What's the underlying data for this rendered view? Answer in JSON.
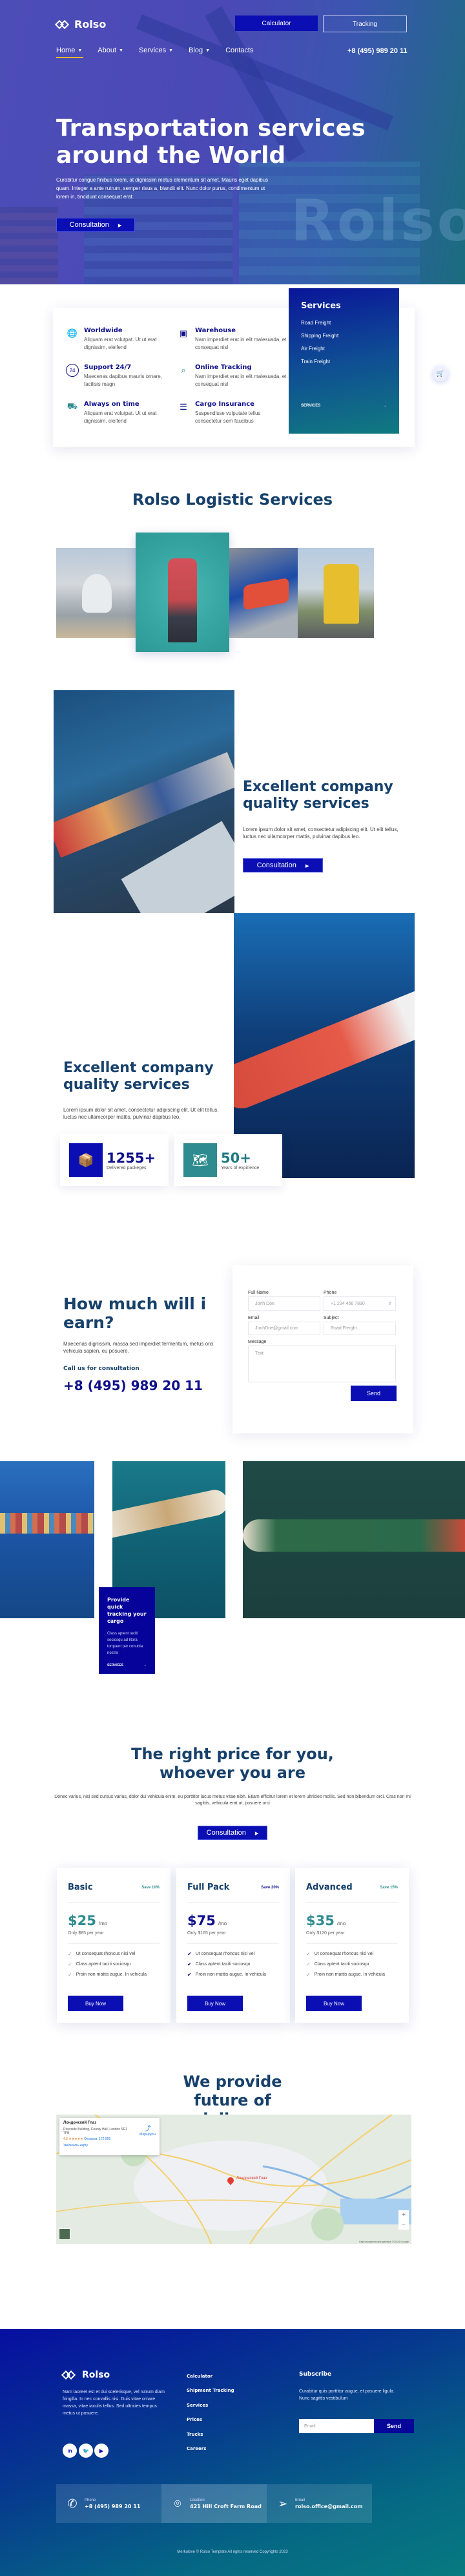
{
  "header": {
    "brand": "Rolso",
    "calculator_label": "Calculator",
    "tracking_label": "Tracking",
    "nav": [
      {
        "label": "Home",
        "dropdown": true,
        "active": true
      },
      {
        "label": "About",
        "dropdown": true
      },
      {
        "label": "Services",
        "dropdown": true
      },
      {
        "label": "Blog",
        "dropdown": true
      },
      {
        "label": "Contacts",
        "dropdown": false
      }
    ],
    "phone": "+8 (495) 989 20 11"
  },
  "hero": {
    "title": "Transportation services around the World",
    "text": "Curabitur congue finibus lorem, at dignissim metus elementum sit amet. Mauris eget dapibus quam. Integer a ante rutrum, semper risus a, blandit elit. Nunc dolor purus, condimentum ut lorem in, tincidunt consequat erat.",
    "button_label": "Consultation",
    "watermark": "Rolso"
  },
  "features": [
    {
      "icon": "globe-icon",
      "title": "Worldwide",
      "desc": "Aliquam erat volutpat. Ut ut erat dignissim, eleifend"
    },
    {
      "icon": "warehouse-box-icon",
      "title": "Warehouse",
      "desc": "Nam imperdiet erat in elit malesuada, et consequat nisl"
    },
    {
      "icon": "support-24-icon",
      "title": "Support 24/7",
      "desc": "Maecenas dapibus mauris ornare, facilisis magn"
    },
    {
      "icon": "tracking-search-icon",
      "title": "Online Tracking",
      "desc": "Nam imperdiet erat in elit malesuada, et consequat nisl"
    },
    {
      "icon": "truck-clock-icon",
      "title": "Always on time",
      "desc": "Aliquam erat volutpat. Ut ut erat dignissim, eleifend"
    },
    {
      "icon": "clipboard-icon",
      "title": "Cargo Insurance",
      "desc": "Suspendisse vulputate tellus consectetur sem faucibus"
    }
  ],
  "services_panel": {
    "title": "Services",
    "links": [
      "Road Freight",
      "Shipping Freight",
      "Air Freight",
      "Train Freight"
    ],
    "more_label": "SERVICES"
  },
  "logistic": {
    "title": "Rolso Logistic Services",
    "images": [
      "airplane-photo",
      "container-ship-photo",
      "train-photo",
      "truck-photo"
    ]
  },
  "excellent_1": {
    "title": "Excellent company quality services",
    "text": "Lorem ipsum dolor sit amet, consectetur adipiscing elit. Ut elit tellus, luctus nec ullamcorper mattis, pulvinar dapibus leo.",
    "button_label": "Consultation"
  },
  "excellent_2": {
    "title": "Excellent company quality services",
    "text": "Lorem ipsum dolor sit amet, consectetur adipiscing elit. Ut elit tellus, luctus nec ullamcorper mattis, pulvinar dapibus leo.",
    "stats": [
      {
        "value": "1255+",
        "label": "Delivered packeges",
        "color": "#0b0fb3"
      },
      {
        "value": "50+",
        "label": "Years of expirience",
        "color": "#2e8b8f"
      }
    ]
  },
  "earn": {
    "title": "How much will i earn?",
    "text": "Maecenas dignissim, massa sed imperdiet fermentum, metus orci vehicula sapien, eu posuere.",
    "call_label": "Call us for consultation",
    "phone": "+8 (495) 989 20 11"
  },
  "form": {
    "full_name_label": "Full Name",
    "full_name_placeholder": "Jonh Doe",
    "phone_label": "Phone",
    "phone_placeholder": "+1 234 456 7890",
    "email_label": "Email",
    "email_placeholder": "JonhDoe@gmail.com",
    "subject_label": "Subject",
    "subject_value": "Road Freight",
    "message_label": "Message",
    "message_placeholder": "Text",
    "send_label": "Send"
  },
  "tracking_card": {
    "title": "Provide quick tracking your cargo",
    "text": "Class aptent taciti sociosqu ad litora torquent per conubia nostra",
    "more_label": "SERVICES"
  },
  "pricing": {
    "title": "The right price for you, whoever you are",
    "text": "Donec varius, nisi sed cursus varius, dolor dui vehicula enim, eu porttitor lacus metus vitae nibh. Etiam efficitur lorem et lorem ultricies mollis. Sed non bibendum orci. Cras non mi sagittis, vehicula erat ut, posuere orci",
    "button_label": "Consultation",
    "plans": [
      {
        "name": "Basic",
        "save": "Save 10%",
        "price": "$25",
        "per": "/mo",
        "year": "Only $85 per year",
        "accent": "#2e8b8f",
        "features": [
          "Ut consequat rhoncus nisi vel",
          "Class aptent taciti sociosqu",
          "Proin non mattis augue. In vehicula"
        ],
        "buy_label": "Buy Now"
      },
      {
        "name": "Full Pack",
        "save": "Save 20%",
        "price": "$75",
        "per": "/mo",
        "year": "Only $165 per year",
        "accent": "#0e0f8a",
        "features": [
          "Ut consequat rhoncus nisi vel",
          "Class aptent taciti sociosqu",
          "Proin non mattis augue. In vehicula"
        ],
        "buy_label": "Buy Now"
      },
      {
        "name": "Advanced",
        "save": "Save 15%",
        "price": "$35",
        "per": "/mo",
        "year": "Only $120 per year",
        "accent": "#2e8b8f",
        "features": [
          "Ut consequat rhoncus nisi vel",
          "Class aptent taciti sociosqu",
          "Proin non mattis augue. In vehicula"
        ],
        "buy_label": "Buy Now"
      }
    ]
  },
  "map": {
    "title": "We provide future of delivery",
    "place_name": "Лондонский Глаз",
    "address": "Riverside Building, County Hall, London SE1 7PB",
    "rating": "4,5 ★★★★★",
    "reviews": "Отзывов: 172 066",
    "enlarge": "Увеличить карту",
    "routes": "Маршруты",
    "marker_label": "Лондонский Глаз",
    "zoom_in": "+",
    "zoom_out": "−",
    "attribution": "Картографические данные ©2024 Google"
  },
  "footer": {
    "brand": "Rolso",
    "about": "Nam laoreet est et dui scelerisque, vel rutrum diam fringilla. In nec convallis nisi. Duis vitae ornare massa, vitae iaculis tellus. Sed ultricies tempus metus ut posuere.",
    "social": [
      "linkedin-icon",
      "twitter-icon",
      "youtube-icon"
    ],
    "links": [
      "Calculator",
      "Shipment Tracking",
      "Services",
      "Prices",
      "Trucks",
      "Careers"
    ],
    "subscribe_title": "Subscribe",
    "subscribe_text": "Curabitur quis porttitor augue, et posuere ligula. Nunc sagittis vestibulum",
    "email_placeholder": "Email",
    "send_label": "Send",
    "contacts": [
      {
        "icon": "phone-icon",
        "label": "Phone",
        "value": "+8 (495) 989 20 11"
      },
      {
        "icon": "location-pin-icon",
        "label": "Location",
        "value": "421 Hill Croft Farm Road"
      },
      {
        "icon": "paper-plane-icon",
        "label": "Email",
        "value": "rolso.office@gmail.com"
      }
    ],
    "copyright": "Merkulove © Rolso Template All rights reserved Copyrights 2023"
  }
}
